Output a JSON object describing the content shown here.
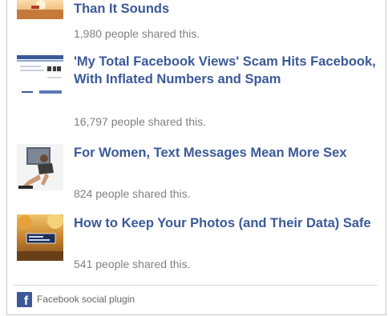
{
  "articles": [
    {
      "title": "Than It Sounds",
      "shares": "1,980 people shared this.",
      "thumb_icon": "sunset-landscape-thumbnail"
    },
    {
      "title": "'My Total Facebook Views' Scam Hits Facebook, With Inflated Numbers and Spam",
      "shares": "16,797 people shared this.",
      "thumb_icon": "webpage-screenshot-thumbnail"
    },
    {
      "title": "For Women, Text Messages Mean More Sex",
      "shares": "824 people shared this.",
      "thumb_icon": "woman-with-laptop-thumbnail"
    },
    {
      "title": "How to Keep Your Photos (and Their Data) Safe",
      "shares": "541 people shared this.",
      "thumb_icon": "autumn-photos-thumbnail"
    }
  ],
  "footer": {
    "label": "Facebook social plugin",
    "logo_letter": "f",
    "logo_icon": "facebook-logo-icon",
    "brand_color": "#3b5998"
  },
  "colors": {
    "title": "#3b5998",
    "shares": "#808080"
  }
}
